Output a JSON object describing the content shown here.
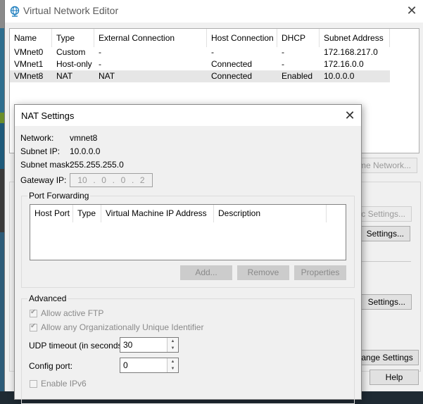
{
  "window": {
    "title": "Virtual Network Editor"
  },
  "networks": {
    "headers": [
      "Name",
      "Type",
      "External Connection",
      "Host Connection",
      "DHCP",
      "Subnet Address"
    ],
    "rows": [
      [
        "VMnet0",
        "Custom",
        "-",
        "-",
        "-",
        "172.168.217.0"
      ],
      [
        "VMnet1",
        "Host-only",
        "-",
        "Connected",
        "-",
        "172.16.0.0"
      ],
      [
        "VMnet8",
        "NAT",
        "NAT",
        "Connected",
        "Enabled",
        "10.0.0.0"
      ]
    ]
  },
  "background_buttons": {
    "rename_network": "ame Network...",
    "automatic_settings": "tic Settings...",
    "nat_settings": "Settings...",
    "dhcp_settings": "Settings...",
    "change_settings": "Change Settings",
    "help": "Help"
  },
  "nat_dialog": {
    "title": "NAT Settings",
    "network_label": "Network:",
    "network_value": "vmnet8",
    "subnet_ip_label": "Subnet IP:",
    "subnet_ip_value": "10.0.0.0",
    "subnet_mask_label": "Subnet mask:",
    "subnet_mask_value": "255.255.255.0",
    "gateway_label": "Gateway IP:",
    "gateway_octets": [
      "10",
      "0",
      "0",
      "2"
    ],
    "port_forwarding": {
      "title": "Port Forwarding",
      "headers": [
        "Host Port",
        "Type",
        "Virtual Machine IP Address",
        "Description"
      ],
      "add_button": "Add...",
      "remove_button": "Remove",
      "properties_button": "Properties"
    },
    "advanced": {
      "title": "Advanced",
      "allow_ftp": "Allow active FTP",
      "allow_oui": "Allow any Organizationally Unique Identifier",
      "udp_timeout_label": "UDP timeout (in seconds):",
      "udp_timeout_value": "30",
      "config_port_label": "Config port:",
      "config_port_value": "0",
      "enable_ipv6": "Enable IPv6"
    }
  }
}
